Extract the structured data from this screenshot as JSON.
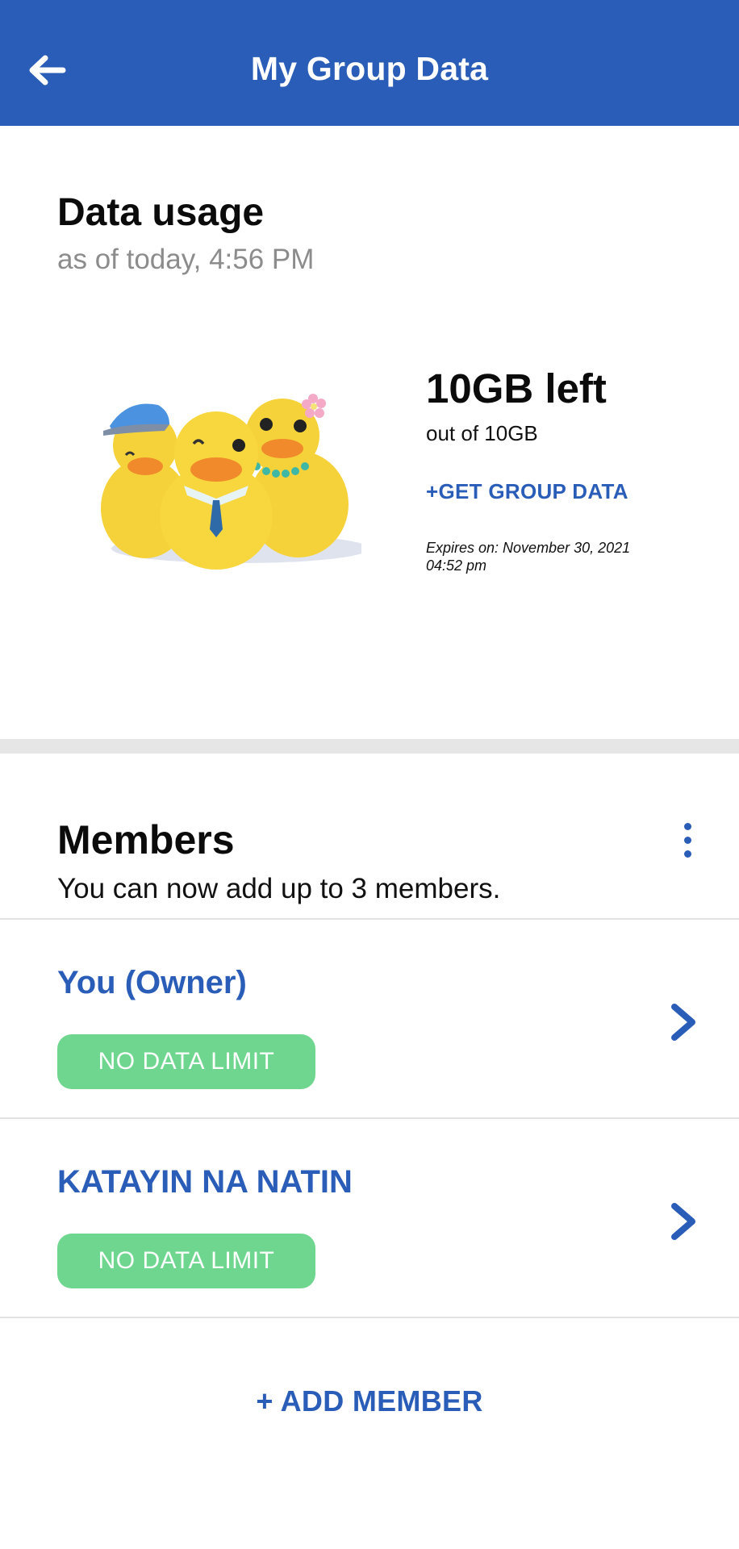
{
  "header": {
    "title": "My Group Data",
    "back_icon": "arrow-left-icon",
    "background": "#2a5db8"
  },
  "usage": {
    "title": "Data usage",
    "as_of": "as of today, 4:56 PM",
    "illustration": "duck-family-mascot",
    "remaining": "10GB left",
    "total": "out of 10GB",
    "get_group_data_label": "+GET GROUP DATA",
    "expires_line1": "Expires on: November 30, 2021",
    "expires_line2": "04:52 pm"
  },
  "members": {
    "title": "Members",
    "subtitle": "You can now add up to 3 members.",
    "more_icon": "more-vertical-icon",
    "items": [
      {
        "name": "You (Owner)",
        "badge": "NO DATA LIMIT",
        "chevron_icon": "chevron-right-icon"
      },
      {
        "name": "KATAYIN NA NATIN",
        "badge": "NO DATA LIMIT",
        "chevron_icon": "chevron-right-icon"
      }
    ],
    "add_label": "+ ADD MEMBER"
  },
  "colors": {
    "accent": "#2a5db8",
    "badge_green": "#6fd68f",
    "muted_text": "#8c8c8c",
    "divider": "#e6e6e6"
  }
}
